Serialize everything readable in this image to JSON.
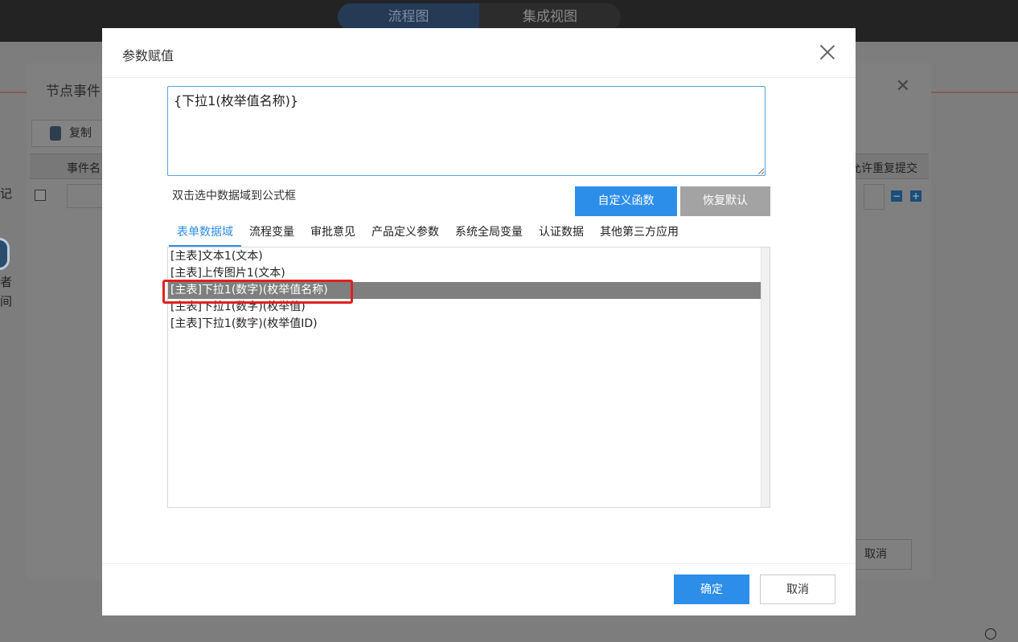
{
  "background": {
    "view_tabs": [
      "流程图",
      "集成视图"
    ],
    "dialog_title": "节点事件",
    "copy_label": "复制",
    "col_event_name": "事件名",
    "col_allow_resubmit": "允许重复提交",
    "cancel_label": "取消",
    "left_labels": [
      "记",
      "者",
      "间"
    ]
  },
  "modal": {
    "title": "参数赋值",
    "formula_value": "{下拉1(枚举值名称)}",
    "hint": "双击选中数据域到公式框",
    "custom_function_label": "自定义函数",
    "restore_default_label": "恢复默认",
    "tabs": [
      {
        "label": "表单数据域",
        "active": true
      },
      {
        "label": "流程变量"
      },
      {
        "label": "审批意见"
      },
      {
        "label": "产品定义参数"
      },
      {
        "label": "系统全局变量"
      },
      {
        "label": "认证数据"
      },
      {
        "label": "其他第三方应用"
      }
    ],
    "items": [
      "[主表]文本1(文本)",
      "[主表]上传图片1(文本)",
      "[主表]下拉1(数字)(枚举值名称)",
      "[主表]下拉1(数字)(枚举值)",
      "[主表]下拉1(数字)(枚举值ID)"
    ],
    "selected_index": 2,
    "ok_label": "确定",
    "cancel_label": "取消"
  },
  "colors": {
    "primary": "#2d8eea",
    "selected_row": "#7f7f7f",
    "highlight": "#e02020"
  }
}
